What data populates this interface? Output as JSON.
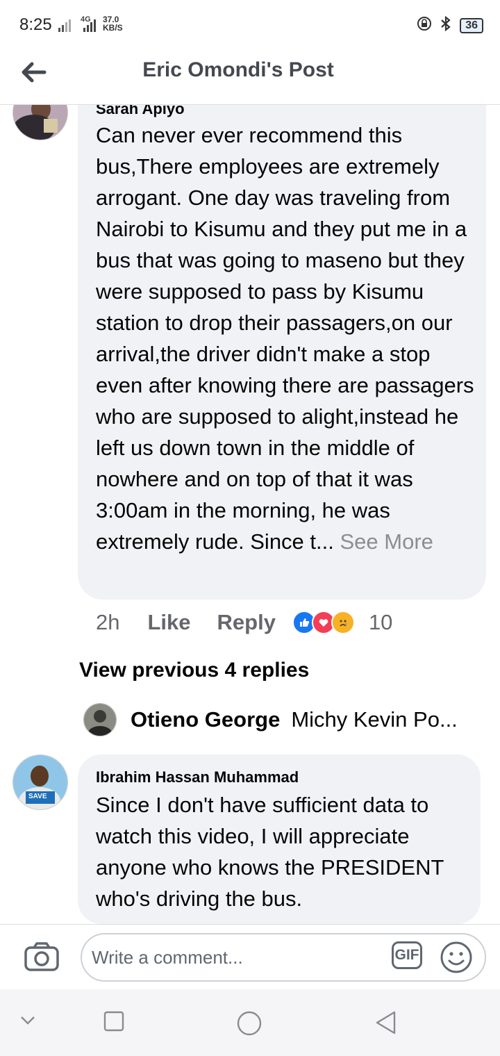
{
  "status_bar": {
    "time": "8:25",
    "network_type": "4G",
    "net_speed_value": "37.0",
    "net_speed_unit": "KB/S",
    "battery_level": "36"
  },
  "header": {
    "title": "Eric Omondi's Post"
  },
  "comments": [
    {
      "author": "Sarah Apiyo",
      "text": "Can never ever recommend this bus,There employees are extremely arrogant. One day was traveling from Nairobi to Kisumu and they put me in a bus that was going to maseno but they were supposed to pass by Kisumu station to drop their passagers,on our arrival,the driver didn't make a stop even after knowing there are passagers who are supposed to alight,instead he left us down town in the middle of nowhere and on top of that it was 3:00am in the morning, he was extremely rude. Since t...",
      "see_more": "See More",
      "time": "2h",
      "like_label": "Like",
      "reply_label": "Reply",
      "reaction_count": "10",
      "reactions": [
        "like",
        "love",
        "sad"
      ],
      "view_previous": "View previous 4 replies",
      "latest_reply": {
        "author": "Otieno George",
        "preview": "Michy Kevin Po..."
      }
    },
    {
      "author": "Ibrahim Hassan Muhammad",
      "text": "Since I don't have sufficient data to watch this video, I will appreciate anyone who knows the PRESIDENT who's driving the bus.",
      "avatar_badge": "SAVE"
    }
  ],
  "composer": {
    "placeholder": "Write a comment...",
    "gif_label": "GIF"
  },
  "colors": {
    "bubble": "#f0f2f5",
    "like_blue": "#1877f2",
    "love_red": "#f33e58",
    "sad_yellow": "#f7b125",
    "secondary_text": "#65676b"
  }
}
